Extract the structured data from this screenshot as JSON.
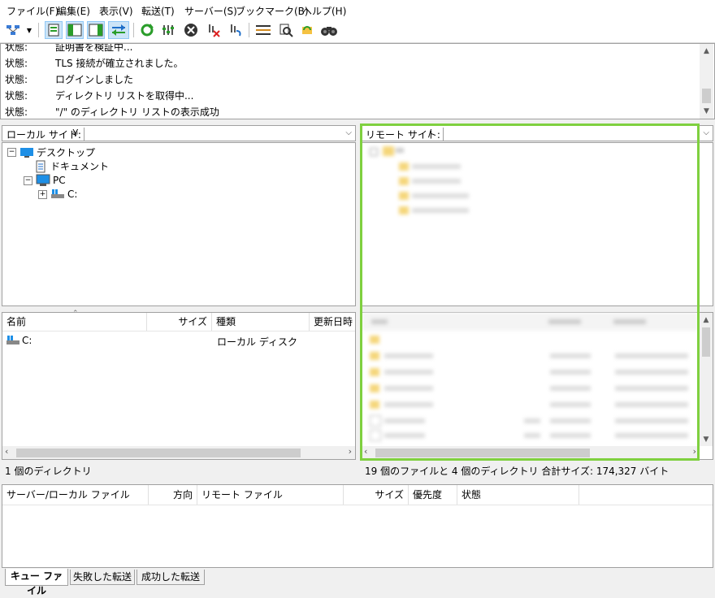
{
  "menu": [
    "ファイル(F)",
    "編集(E)",
    "表示(V)",
    "転送(T)",
    "サーバー(S)",
    "ブックマーク(B)",
    "ヘルプ(H)"
  ],
  "toolbar": {
    "icons": [
      "site-manager-icon",
      "dropdown-arrow-icon",
      "toggle-log-icon",
      "toggle-local-tree-icon",
      "toggle-remote-tree-icon",
      "toggle-queue-icon",
      "refresh-icon",
      "process-queue-icon",
      "cancel-icon",
      "disconnect-icon",
      "reconnect-icon",
      "filter-icon",
      "compare-icon",
      "sync-browse-icon",
      "search-icon"
    ]
  },
  "log": [
    {
      "label": "状態:",
      "text": "証明書を検証中..."
    },
    {
      "label": "状態:",
      "text": "TLS 接続が確立されました。"
    },
    {
      "label": "状態:",
      "text": "ログインしました"
    },
    {
      "label": "状態:",
      "text": "ディレクトリ リストを取得中..."
    },
    {
      "label": "状態:",
      "text": "\"/\" のディレクトリ リストの表示成功"
    }
  ],
  "local": {
    "site_label": "ローカル サイト:",
    "path": "¥",
    "tree": [
      {
        "label": "デスクトップ",
        "icon": "desktop-icon"
      },
      {
        "label": "ドキュメント",
        "icon": "document-icon"
      },
      {
        "label": "PC",
        "icon": "computer-icon"
      },
      {
        "label": "C:",
        "icon": "drive-icon"
      }
    ],
    "columns": [
      "名前",
      "サイズ",
      "種類",
      "更新日時"
    ],
    "rows": [
      {
        "name": "C:",
        "size": "",
        "type": "ローカル ディスク"
      }
    ],
    "status": "1 個のディレクトリ"
  },
  "remote": {
    "site_label": "リモート サイト:",
    "path": "/",
    "status": "19 個のファイルと 4 個のディレクトリ 合計サイズ: 174,327 バイト"
  },
  "queue": {
    "columns": [
      "サーバー/ローカル ファイル",
      "方向",
      "リモート ファイル",
      "サイズ",
      "優先度",
      "状態"
    ],
    "tabs": [
      "キュー ファイル",
      "失敗した転送",
      "成功した転送"
    ]
  },
  "colors": {
    "highlight": "#7fd03f",
    "folder": "#f5d67a"
  }
}
